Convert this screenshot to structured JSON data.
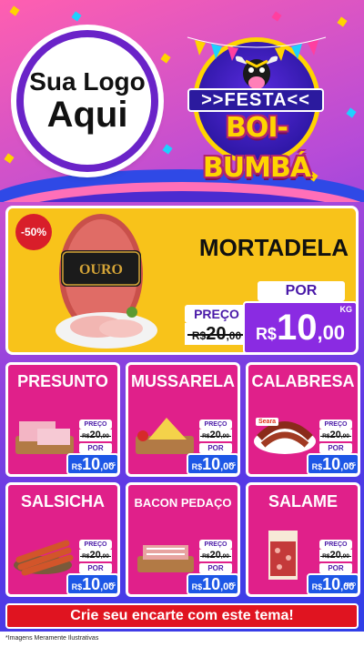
{
  "logo": {
    "line1": "Sua Logo",
    "line2": "Aqui"
  },
  "festa": {
    "ribbon": ">>FESTA<<",
    "title": "BOI-BUMBÁ"
  },
  "featured": {
    "name": "MORTADELA",
    "discount": "-50%",
    "brand": "OURO",
    "price_label": "PREÇO",
    "old_price": "20",
    "old_cents": ",00",
    "currency": "R$",
    "por_label": "POR",
    "new_price": "10",
    "new_cents": ",00",
    "unit": "KG"
  },
  "products": [
    {
      "name": "PRESUNTO",
      "price_label": "PREÇO",
      "old_price": "20",
      "old_cents": ",00",
      "por_label": "POR",
      "currency": "R$",
      "new_price": "10",
      "new_cents": ",00",
      "unit": "KG"
    },
    {
      "name": "MUSSARELA",
      "price_label": "PREÇO",
      "old_price": "20",
      "old_cents": ",00",
      "por_label": "POR",
      "currency": "R$",
      "new_price": "10",
      "new_cents": ",00",
      "unit": "KG"
    },
    {
      "name": "CALABRESA",
      "price_label": "PREÇO",
      "old_price": "20",
      "old_cents": ",00",
      "por_label": "POR",
      "currency": "R$",
      "new_price": "10",
      "new_cents": ",00",
      "unit": "KG",
      "brand": "Seara"
    },
    {
      "name": "SALSICHA",
      "price_label": "PREÇO",
      "old_price": "20",
      "old_cents": ",00",
      "por_label": "POR",
      "currency": "R$",
      "new_price": "10",
      "new_cents": ",00",
      "unit": "KG"
    },
    {
      "name": "BACON PEDAÇO",
      "price_label": "PREÇO",
      "old_price": "20",
      "old_cents": ",00",
      "por_label": "POR",
      "currency": "R$",
      "new_price": "10",
      "new_cents": ",00",
      "unit": "KG"
    },
    {
      "name": "SALAME",
      "price_label": "PREÇO",
      "old_price": "20",
      "old_cents": ",00",
      "por_label": "POR",
      "currency": "R$",
      "new_price": "10",
      "new_cents": ",00",
      "unit": "UNID"
    }
  ],
  "cta": "Crie seu encarte com este tema!",
  "footnote": "*Imagens Meramente Ilustrativas",
  "colors": {
    "card_pink": "#e0208a",
    "featured_yellow": "#f8c31a",
    "price_blue": "#1d57e6",
    "price_purple": "#8a2be2",
    "cta_red": "#e01420"
  }
}
